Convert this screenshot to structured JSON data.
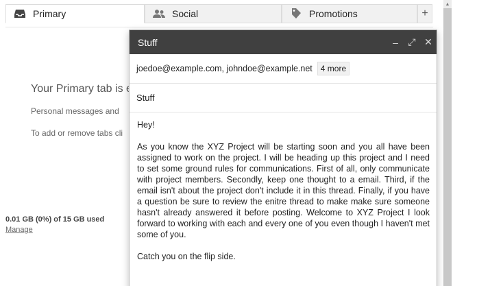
{
  "tabs": [
    {
      "label": "Primary",
      "icon": "inbox-icon"
    },
    {
      "label": "Social",
      "icon": "people-icon"
    },
    {
      "label": "Promotions",
      "icon": "tag-icon"
    }
  ],
  "add_tab_label": "+",
  "background": {
    "heading": "Your Primary tab is e",
    "line1": "Personal messages and",
    "line2": "To add or remove tabs cli",
    "storage": "0.01 GB (0%) of 15 GB used",
    "manage": "Manage"
  },
  "compose": {
    "title": "Stuff",
    "minimize": "–",
    "expand": "⤢",
    "close": "✕",
    "recipients": "joedoe@example.com, johndoe@example.net",
    "more": "4 more",
    "subject": "Stuff",
    "body": {
      "greeting": "Hey!",
      "paragraph": "As you know the XYZ Project will be starting soon and you all have been assigned to work on the project. I will be heading up this project and I need to set some ground rules for communications. First of all, only communicate with project members. Secondly, keep one thought to a email. Third, if the email isn't about the project don't include it in this thread. Finally, if you have a question be sure to review the enitre thread to make make sure someone hasn't already answered it before posting. Welcome to XYZ Project I look forward to working with each and every one of you even though I haven't met some of you.",
      "signoff": "Catch you on the flip side."
    }
  }
}
